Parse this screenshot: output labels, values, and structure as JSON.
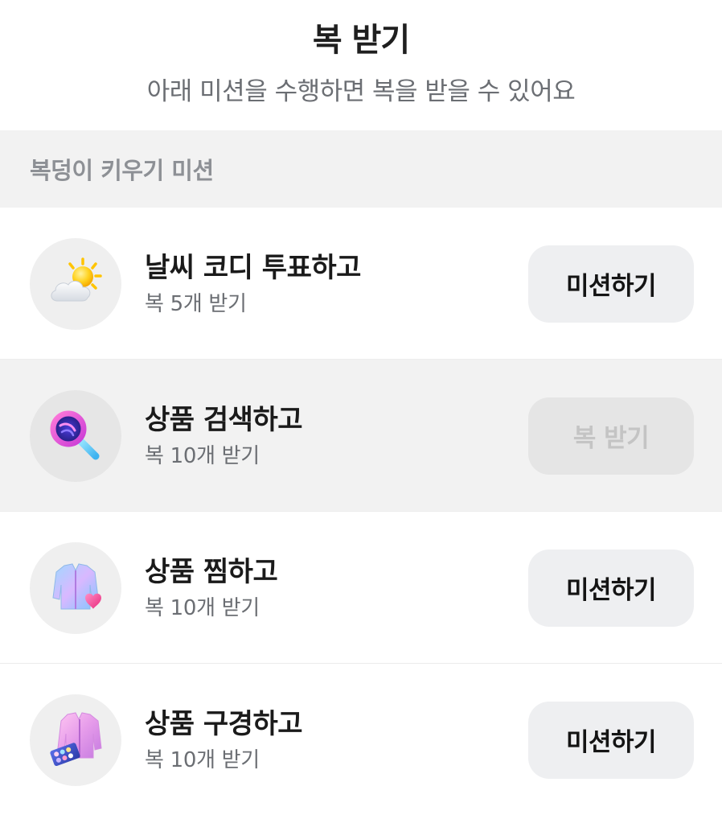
{
  "header": {
    "title": "복 받기",
    "subtitle": "아래 미션을 수행하면 복을 받을 수 있어요"
  },
  "section": {
    "title": "복덩이 키우기 미션"
  },
  "missions": [
    {
      "icon": "weather-sun-cloud-icon",
      "name": "날씨 코디 투표하고",
      "reward": "복 5개 받기",
      "button": "미션하기",
      "completed": false
    },
    {
      "icon": "magnifier-search-icon",
      "name": "상품 검색하고",
      "reward": "복 10개 받기",
      "button": "복 받기",
      "completed": true
    },
    {
      "icon": "jacket-heart-icon",
      "name": "상품 찜하고",
      "reward": "복 10개 받기",
      "button": "미션하기",
      "completed": false
    },
    {
      "icon": "jacket-palette-icon",
      "name": "상품 구경하고",
      "reward": "복 10개 받기",
      "button": "미션하기",
      "completed": false
    }
  ],
  "colors": {
    "title": "#1f1f1f",
    "subtitle": "#6b6e73",
    "section_bg": "#f2f2f2",
    "section_text": "#8d9095",
    "button_bg": "#eeeff1",
    "button_disabled_text": "#c4c4c4"
  }
}
